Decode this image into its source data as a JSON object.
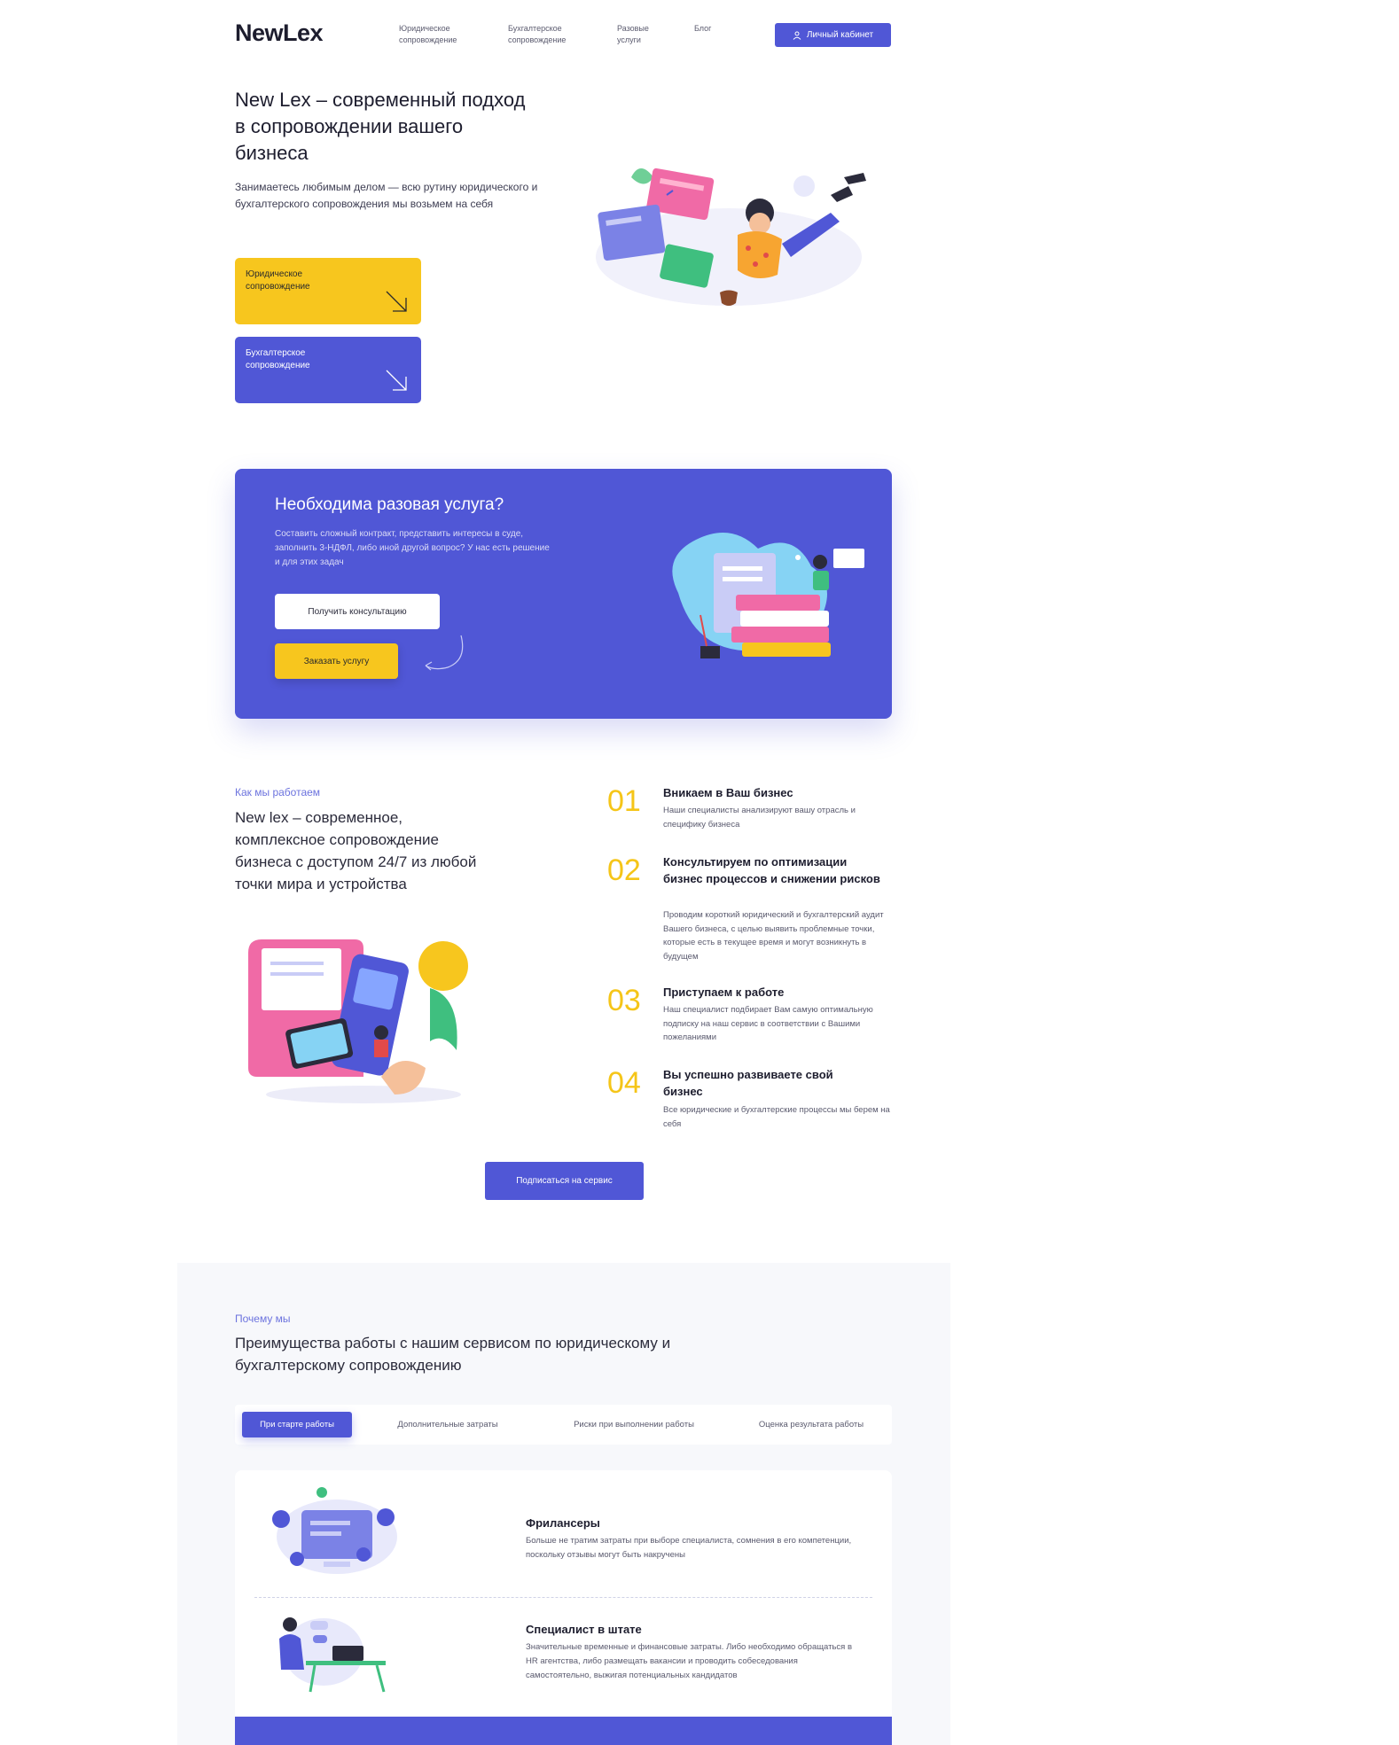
{
  "colors": {
    "accent": "#5057d6",
    "yellow": "#f7c61e",
    "text": "#1d1d2e"
  },
  "header": {
    "logo": "NewLex",
    "nav": [
      "Юридическое\nсопровождение",
      "Бухгалтерское\nсопровождение",
      "Разовые\nуслуги",
      "Блог"
    ],
    "cabinet_label": "Личный кабинет",
    "cabinet_icon": "user-icon"
  },
  "hero": {
    "title": "New Lex – современный подход в сопровождении вашего бизнеса",
    "description": "Занимаетесь любимым делом — всю рутину юридического и бухгалтерского сопровождения мы возьмем на себя",
    "cards": [
      {
        "label": "Юридическое\nсопровождение",
        "icon": "arrow-down-right-icon"
      },
      {
        "label": "Бухгалтерское\nсопровождение",
        "icon": "arrow-down-right-icon"
      }
    ]
  },
  "banner": {
    "title": "Необходима разовая услуга?",
    "text": "Составить сложный контракт, представить интересы в суде, заполнить 3-НДФЛ, либо иной другой вопрос? У нас есть решение и для этих задач",
    "consult_label": "Получить консультацию",
    "order_label": "Заказать услугу"
  },
  "how": {
    "label": "Как мы работаем",
    "title": "New lex – современное, комплексное сопровождение бизнеса с доступом 24/7 из любой точки мира и устройства",
    "steps": [
      {
        "num": "01",
        "title": "Вникаем в Ваш бизнес",
        "text": "Наши специалисты анализируют вашу отрасль и специфику бизнеса"
      },
      {
        "num": "02",
        "title": "Консультируем по оптимизации бизнес процессов и снижении рисков",
        "text": "Проводим короткий юридический и бухгалтерский аудит Вашего бизнеса, с целью выявить проблемные точки, которые есть в текущее время и могут возникнуть в будущем"
      },
      {
        "num": "03",
        "title": "Приступаем к работе",
        "text": "Наш специалист подбирает Вам самую оптимальную подписку на наш сервис в соответствии с Вашими пожеланиями"
      },
      {
        "num": "04",
        "title": "Вы успешно развиваете свой бизнес",
        "text": "Все юридические и бухгалтерские процессы мы берем на себя"
      }
    ],
    "subscribe_label": "Подписаться на сервис"
  },
  "why": {
    "label": "Почему мы",
    "title": "Преимущества работы с нашим сервисом по юридическому и бухгалтерскому сопровождению",
    "tabs": [
      "При старте работы",
      "Дополнительные затраты",
      "Риски при выполнении работы",
      "Оценка результата работы"
    ],
    "rows": [
      {
        "title": "Фрилансеры",
        "text": "Больше не тратим затраты при выборе специалиста, сомнения в его компетенции, поскольку отзывы могут быть накручены"
      },
      {
        "title": "Специалист в штате",
        "text": "Значительные временные и финансовые затраты. Либо необходимо обращаться в HR агентства, либо размещать вакансии и проводить собеседования самостоятельно, выжигая потенциальных кандидатов"
      }
    ]
  }
}
